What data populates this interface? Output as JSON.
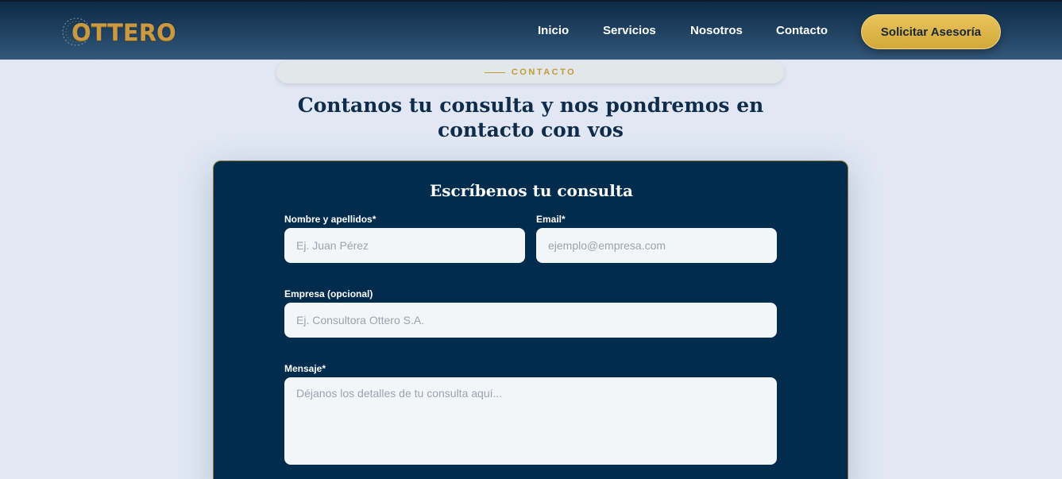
{
  "header": {
    "logo_text": "OTTERO",
    "nav": [
      {
        "label": "Inicio"
      },
      {
        "label": "Servicios"
      },
      {
        "label": "Nosotros"
      },
      {
        "label": "Contacto"
      }
    ],
    "cta_label": "Solicitar Asesoría"
  },
  "section": {
    "eyebrow": "CONTACTO",
    "title": "Contanos tu consulta y nos pondremos en contacto con vos"
  },
  "form": {
    "title": "Escríbenos tu consulta",
    "name": {
      "label": "Nombre y apellidos*",
      "placeholder": "Ej. Juan Pérez"
    },
    "email": {
      "label": "Email*",
      "placeholder": "ejemplo@empresa.com"
    },
    "company": {
      "label": "Empresa (opcional)",
      "placeholder": "Ej. Consultora Ottero S.A."
    },
    "message": {
      "label": "Mensaje*",
      "placeholder": "Déjanos los detalles de tu consulta aquí..."
    }
  },
  "colors": {
    "brand_gold": "#d4a83a",
    "navy": "#022c4e",
    "page_bg": "#e1e8f4"
  }
}
